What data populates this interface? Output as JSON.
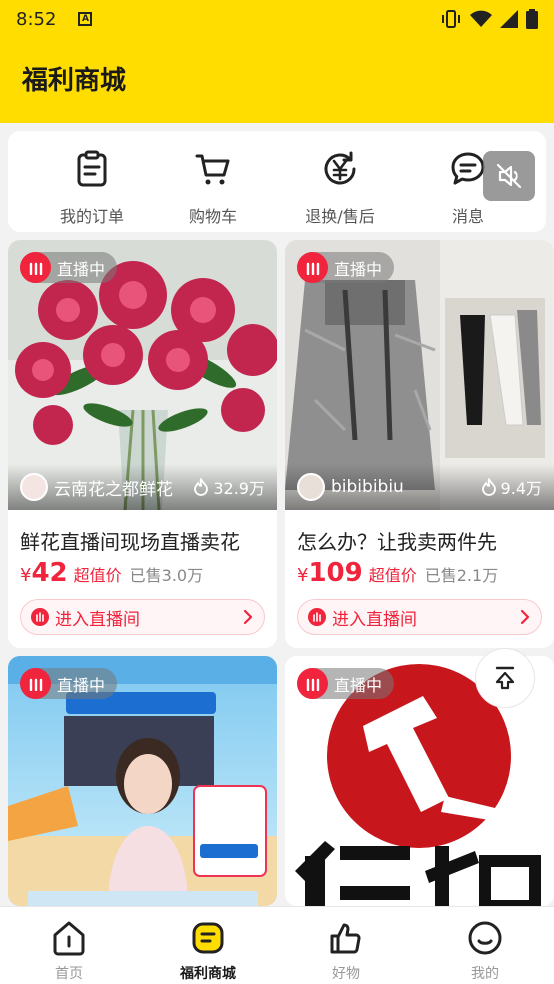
{
  "status_bar": {
    "time": "8:52",
    "indicator": "A"
  },
  "header": {
    "title": "福利商城"
  },
  "shortcuts": [
    {
      "label": "我的订单",
      "icon": "order-list-icon"
    },
    {
      "label": "购物车",
      "icon": "cart-icon"
    },
    {
      "label": "退换/售后",
      "icon": "yen-refund-icon"
    },
    {
      "label": "消息",
      "icon": "message-icon"
    }
  ],
  "cards": [
    {
      "live_label": "直播中",
      "streamer": "云南花之都鲜花",
      "heat": "32.9万",
      "title": "鲜花直播间现场直播卖花",
      "yen": "¥",
      "price": "42",
      "deal": "超值价",
      "sold": "已售3.0万",
      "enter": "进入直播间"
    },
    {
      "live_label": "直播中",
      "streamer": "bibibibiu",
      "heat": "9.4万",
      "title": "怎么办？让我卖两件先",
      "yen": "¥",
      "price": "109",
      "deal": "超值价",
      "sold": "已售2.1万",
      "enter": "进入直播间"
    },
    {
      "live_label": "直播中"
    },
    {
      "live_label": "直播中"
    }
  ],
  "tabbar": [
    {
      "label": "首页",
      "icon": "home-icon"
    },
    {
      "label": "福利商城",
      "icon": "mall-icon",
      "active": true
    },
    {
      "label": "好物",
      "icon": "thumbs-up-icon"
    },
    {
      "label": "我的",
      "icon": "profile-icon"
    }
  ],
  "colors": {
    "brand_yellow": "#ffdd00",
    "accent_red": "#f0243c"
  }
}
